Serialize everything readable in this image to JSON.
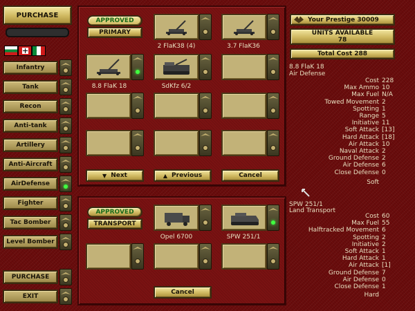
{
  "sidebar": {
    "purchase_label": "PURCHASE",
    "categories": [
      {
        "label": "Infantry",
        "active": false
      },
      {
        "label": "Tank",
        "active": false
      },
      {
        "label": "Recon",
        "active": false
      },
      {
        "label": "Anti-tank",
        "active": false
      },
      {
        "label": "Artillery",
        "active": false
      },
      {
        "label": "Anti-Aircraft",
        "active": false
      },
      {
        "label": "AirDefense",
        "active": true
      },
      {
        "label": "Fighter",
        "active": false
      },
      {
        "label": "Tac Bomber",
        "active": false
      },
      {
        "label": "Level Bomber",
        "active": false
      }
    ],
    "bottom_purchase_label": "PURCHASE",
    "exit_label": "EXIT",
    "flags": [
      "bulgaria-flag",
      "germany-flag",
      "italy-flag"
    ]
  },
  "top_panel": {
    "approved_label": "APPROVED",
    "primary_label": "PRIMARY",
    "units": [
      {
        "name": "2 FlaK38 (4)",
        "icon": "aa-gun-icon",
        "selected": false
      },
      {
        "name": "3.7 FlaK36",
        "icon": "aa-gun-icon",
        "selected": false
      },
      {
        "name": "8.8 FlaK 18",
        "icon": "aa-gun-icon",
        "selected": true
      },
      {
        "name": "SdKfz 6/2",
        "icon": "halftrack-aa-icon",
        "selected": false
      }
    ],
    "next_label": "Next",
    "previous_label": "Previous",
    "cancel_label": "Cancel"
  },
  "bottom_panel": {
    "approved_label": "APPROVED",
    "transport_label": "TRANSPORT",
    "units": [
      {
        "name": "Opel 6700",
        "icon": "truck-icon",
        "selected": false
      },
      {
        "name": "SPW 251/1",
        "icon": "halftrack-icon",
        "selected": true
      }
    ],
    "cancel_label": "Cancel"
  },
  "prestige": {
    "your_prestige": "Your Prestige 30009",
    "units_available_label": "UNITS AVAILABLE",
    "units_available_value": "78",
    "total_cost": "Total Cost 288"
  },
  "unit_stats": {
    "name": "8.8 FlaK 18",
    "class": "Air Defense",
    "rows": [
      {
        "k": "Cost",
        "v": "228"
      },
      {
        "k": "Max Ammo",
        "v": "10"
      },
      {
        "k": "Max Fuel",
        "v": "N/A"
      },
      {
        "k": "Towed Movement",
        "v": "2"
      },
      {
        "k": "Spotting",
        "v": "1"
      },
      {
        "k": "Range",
        "v": "5"
      },
      {
        "k": "Initiative",
        "v": "11"
      },
      {
        "k": "Soft Attack",
        "v": "[13]"
      },
      {
        "k": "Hard Attack",
        "v": "[18]"
      },
      {
        "k": "Air Attack",
        "v": "10"
      },
      {
        "k": "Naval Attack",
        "v": "2"
      },
      {
        "k": "Ground Defense",
        "v": "2"
      },
      {
        "k": "Air Defense",
        "v": "6"
      },
      {
        "k": "Close Defense",
        "v": "0"
      }
    ],
    "target": "Soft"
  },
  "transport_stats": {
    "name": "SPW 251/1",
    "class": "Land Transport",
    "rows": [
      {
        "k": "Cost",
        "v": "60"
      },
      {
        "k": "Max Fuel",
        "v": "55"
      },
      {
        "k": "Halftracked Movement",
        "v": "6"
      },
      {
        "k": "Spotting",
        "v": "2"
      },
      {
        "k": "Initiative",
        "v": "2"
      },
      {
        "k": "Soft Attack",
        "v": "1"
      },
      {
        "k": "Hard Attack",
        "v": "1"
      },
      {
        "k": "Air Attack",
        "v": "[1]"
      },
      {
        "k": "Ground Defense",
        "v": "7"
      },
      {
        "k": "Air Defense",
        "v": "0"
      },
      {
        "k": "Close Defense",
        "v": "1"
      }
    ],
    "target": "Hard"
  }
}
